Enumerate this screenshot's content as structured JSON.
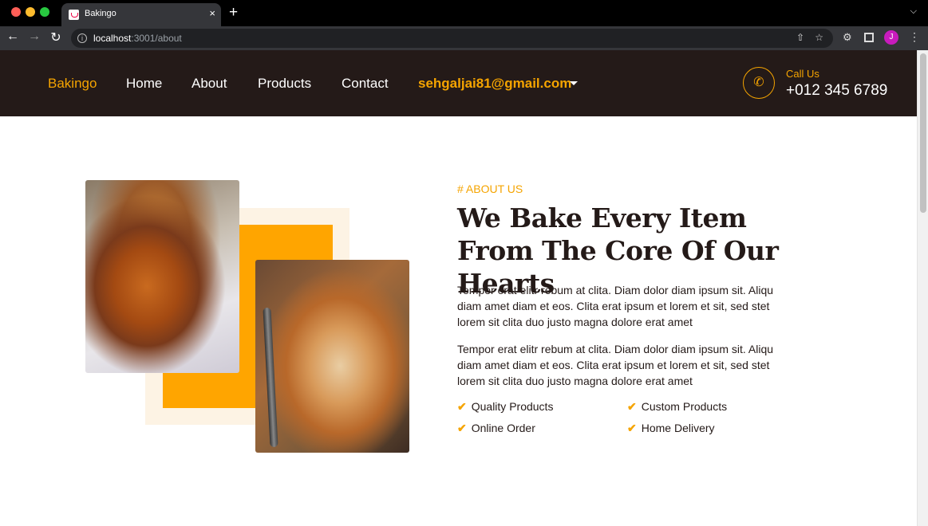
{
  "browser": {
    "tab_title": "Bakingo",
    "tab_close": "×",
    "new_tab": "+",
    "url_host": "localhost",
    "url_rest": ":3001/about",
    "avatar_letter": "J"
  },
  "nav": {
    "brand": "Bakingo",
    "links": [
      "Home",
      "About",
      "Products",
      "Contact"
    ],
    "user_email": "sehgaljai81@gmail.com",
    "call_label": "Call Us",
    "call_number": "+012 345 6789"
  },
  "about": {
    "eyebrow": "# ABOUT US",
    "heading": "We Bake Every Item From The Core Of Our Hearts",
    "paragraphs": [
      "Tempor erat elitr rebum at clita. Diam dolor diam ipsum sit. Aliqu diam amet diam et eos. Clita erat ipsum et lorem et sit, sed stet lorem sit clita duo justo magna dolore erat amet",
      "Tempor erat elitr rebum at clita. Diam dolor diam ipsum sit. Aliqu diam amet diam et eos. Clita erat ipsum et lorem et sit, sed stet lorem sit clita duo justo magna dolore erat amet"
    ],
    "features": [
      "Quality Products",
      "Custom Products",
      "Online Order",
      "Home Delivery"
    ]
  },
  "colors": {
    "accent": "#f5a400",
    "dark": "#241a18"
  }
}
